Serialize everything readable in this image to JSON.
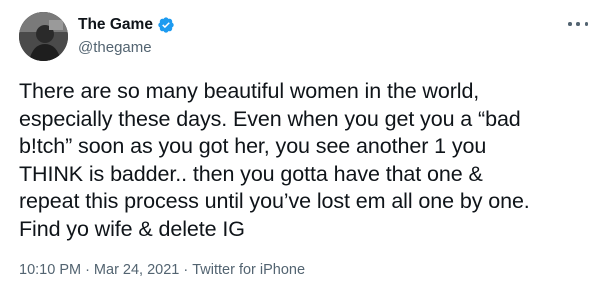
{
  "author": {
    "display_name": "The Game",
    "handle": "@thegame",
    "verified": true,
    "avatar_icon": "avatar-photo"
  },
  "menu": {
    "icon": "more-horizontal-icon"
  },
  "tweet": {
    "text": "There are so many beautiful women in the world,\nespecially these days. Even when you get you a “bad\nb!tch” soon as you got her, you see another 1 you\nTHINK is badder.. then you gotta have that one &\nrepeat this process until you’ve lost em all one by one.\nFind yo wife & delete IG"
  },
  "meta": {
    "time": "10:10 PM",
    "separator": "·",
    "date": "Mar 24, 2021",
    "source": "Twitter for iPhone"
  },
  "colors": {
    "text": "#0f1419",
    "secondary": "#536471",
    "verified": "#1d9bf0"
  }
}
